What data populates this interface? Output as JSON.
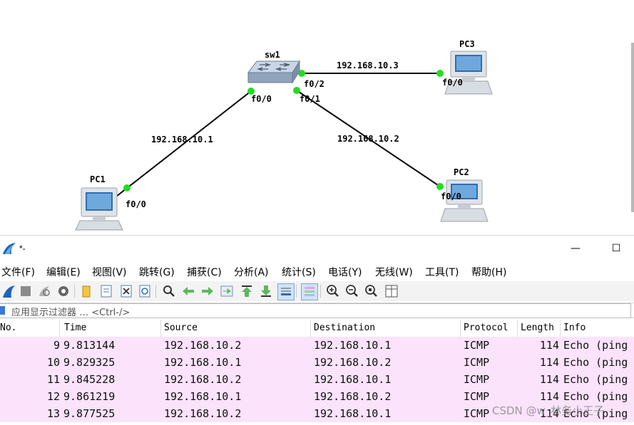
{
  "topology": {
    "switch": {
      "name": "sw1"
    },
    "pcs": [
      {
        "name": "PC1",
        "port": "f0/0"
      },
      {
        "name": "PC2",
        "port": "f0/0"
      },
      {
        "name": "PC3",
        "port": "f0/0"
      }
    ],
    "switch_ports": [
      "f0/0",
      "f0/1",
      "f0/2"
    ],
    "links": [
      {
        "label": "192.168.10.1"
      },
      {
        "label": "192.168.10.2"
      },
      {
        "label": "192.168.10.3"
      }
    ],
    "link_endpoint_color": "#22dd22"
  },
  "window": {
    "title": "*-",
    "minimize_glyph": "—",
    "maximize_glyph": "☐"
  },
  "menu": [
    "文件(F)",
    "编辑(E)",
    "视图(V)",
    "跳转(G)",
    "捕获(C)",
    "分析(A)",
    "统计(S)",
    "电话(Y)",
    "无线(W)",
    "工具(T)",
    "帮助(H)"
  ],
  "toolbar_icons": [
    "shark-fin-icon",
    "stop-capture-icon",
    "restart-capture-icon",
    "capture-options-icon",
    "open-file-icon",
    "save-file-icon",
    "close-file-icon",
    "reload-file-icon",
    "find-packet-icon",
    "go-back-icon",
    "go-forward-icon",
    "go-to-packet-icon",
    "go-first-icon",
    "go-last-icon",
    "autoscroll-icon",
    "colorize-icon",
    "zoom-in-icon",
    "zoom-out-icon",
    "normal-size-icon",
    "resize-columns-icon"
  ],
  "filter": {
    "placeholder": "应用显示过滤器 … <Ctrl-/>"
  },
  "packet_list": {
    "columns": [
      "No.",
      "Time",
      "Source",
      "Destination",
      "Protocol",
      "Length",
      "Info"
    ],
    "rows": [
      {
        "no": "9",
        "time": "9.813144",
        "source": "192.168.10.2",
        "destination": "192.168.10.1",
        "protocol": "ICMP",
        "length": "114",
        "info": "Echo (ping"
      },
      {
        "no": "10",
        "time": "9.829325",
        "source": "192.168.10.1",
        "destination": "192.168.10.2",
        "protocol": "ICMP",
        "length": "114",
        "info": "Echo (ping"
      },
      {
        "no": "11",
        "time": "9.845228",
        "source": "192.168.10.2",
        "destination": "192.168.10.1",
        "protocol": "ICMP",
        "length": "114",
        "info": "Echo (ping"
      },
      {
        "no": "12",
        "time": "9.861219",
        "source": "192.168.10.1",
        "destination": "192.168.10.2",
        "protocol": "ICMP",
        "length": "114",
        "info": "Echo (ping"
      },
      {
        "no": "13",
        "time": "9.877525",
        "source": "192.168.10.2",
        "destination": "192.168.10.1",
        "protocol": "ICMP",
        "length": "114",
        "info": "Echo (ping"
      }
    ],
    "row_color": "#fbe3fb"
  },
  "watermark": "CSDN @w_林务小王子"
}
